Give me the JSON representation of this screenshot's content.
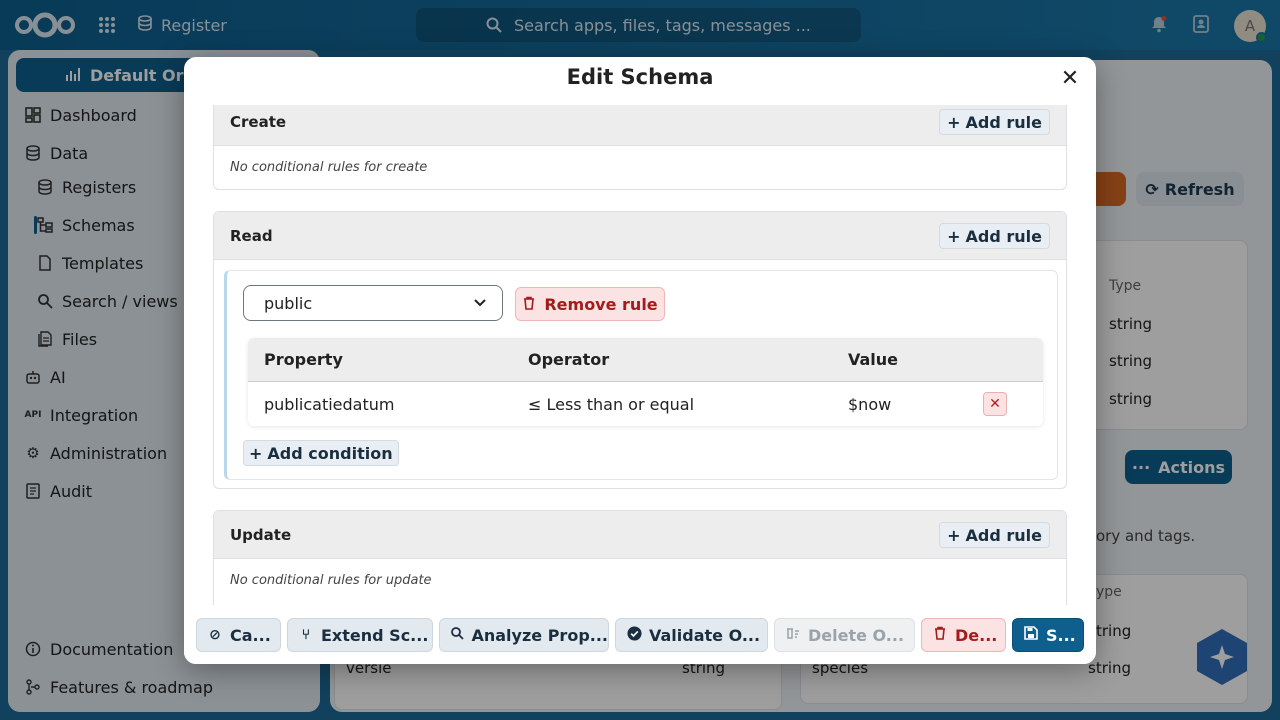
{
  "topbar": {
    "app_name": "Register",
    "search_placeholder": "Search apps, files, tags, messages ...",
    "avatar_initial": "A"
  },
  "sidebar": {
    "org_label": "Default Orga",
    "items": [
      {
        "label": "Dashboard",
        "icon": "dashboard-icon"
      },
      {
        "label": "Data",
        "icon": "database-icon"
      },
      {
        "label": "Registers",
        "icon": "database-icon"
      },
      {
        "label": "Schemas",
        "icon": "schema-icon"
      },
      {
        "label": "Templates",
        "icon": "file-icon"
      },
      {
        "label": "Search / views",
        "icon": "search-icon"
      },
      {
        "label": "Files",
        "icon": "files-icon"
      },
      {
        "label": "AI",
        "icon": "robot-icon"
      },
      {
        "label": "Integration",
        "icon": "api-icon"
      },
      {
        "label": "Administration",
        "icon": "gear-icon"
      },
      {
        "label": "Audit",
        "icon": "audit-icon"
      }
    ],
    "footer_items": [
      {
        "label": "Documentation",
        "icon": "info-icon"
      },
      {
        "label": "Features & roadmap",
        "icon": "roadmap-icon"
      }
    ]
  },
  "background": {
    "refresh_label": "Refresh",
    "actions_label": "Actions",
    "type_header_1": "Type",
    "type_values_1": [
      "string",
      "string",
      "string"
    ],
    "desc_text": "ory and tags.",
    "type_header_2": "ype",
    "type_values_2": [
      "tring",
      "string"
    ],
    "row_left_name": "versie",
    "row_left_type": "string",
    "row_right_name": "species"
  },
  "modal": {
    "title": "Edit Schema",
    "sections": {
      "create": {
        "title": "Create",
        "add_rule": "Add rule",
        "empty": "No conditional rules for create"
      },
      "read": {
        "title": "Read",
        "add_rule": "Add rule"
      },
      "update": {
        "title": "Update",
        "add_rule": "Add rule",
        "empty": "No conditional rules for update"
      }
    },
    "rule": {
      "selected_group": "public",
      "remove_label": "Remove rule",
      "headers": {
        "property": "Property",
        "operator": "Operator",
        "value": "Value"
      },
      "conditions": [
        {
          "property": "publicatiedatum",
          "operator": "≤ Less than or equal",
          "value": "$now"
        }
      ],
      "add_condition": "Add condition"
    },
    "footer": {
      "cancel": "Ca...",
      "extend": "Extend Sc...",
      "analyze": "Analyze Prop...",
      "validate": "Validate O...",
      "delete_objects": "Delete O...",
      "delete": "De...",
      "save": "S..."
    }
  }
}
